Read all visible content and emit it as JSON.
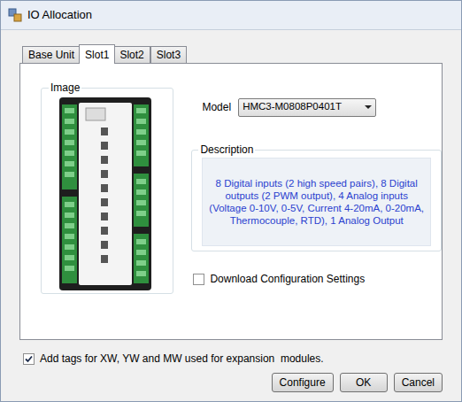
{
  "window": {
    "title": "IO Allocation"
  },
  "tabs": [
    {
      "label": "Base Unit",
      "selected": false
    },
    {
      "label": "Slot1",
      "selected": true
    },
    {
      "label": "Slot2",
      "selected": false
    },
    {
      "label": "Slot3",
      "selected": false
    }
  ],
  "image_group": {
    "label": "Image"
  },
  "model": {
    "label": "Model",
    "value": "HMC3-M0808P0401T"
  },
  "description": {
    "label": "Description",
    "text": "8 Digital inputs (2 high speed pairs), 8 Digital outputs (2 PWM output), 4 Analog inputs (Voltage 0-10V, 0-5V, Current 4-20mA, 0-20mA, Thermocouple, RTD), 1 Analog Output"
  },
  "download_config": {
    "label": "Download Configuration Settings",
    "checked": false
  },
  "add_tags": {
    "label": "Add tags for XW, YW and MW used for expansion  modules.",
    "checked": true
  },
  "buttons": [
    "Configure",
    "OK",
    "Cancel"
  ]
}
